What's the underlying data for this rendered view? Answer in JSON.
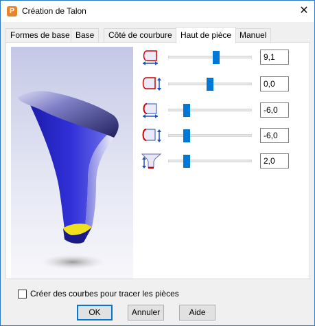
{
  "window": {
    "title": "Création de Talon",
    "app_icon_letter": "P",
    "close_glyph": "✕"
  },
  "tabs": [
    {
      "label": "Formes de base",
      "active": false
    },
    {
      "label": "Base",
      "active": false
    },
    {
      "label": "Côté de courbure",
      "active": false
    },
    {
      "label": "Haut de pièce",
      "active": true
    },
    {
      "label": "Manuel",
      "active": false
    }
  ],
  "rows": [
    {
      "icon": "heel-top-horizontal-icon",
      "value": "9,1",
      "slider_fraction": 0.58
    },
    {
      "icon": "heel-top-vertical-icon",
      "value": "0,0",
      "slider_fraction": 0.5
    },
    {
      "icon": "heel-front-horizontal-icon",
      "value": "-6,0",
      "slider_fraction": 0.2
    },
    {
      "icon": "heel-front-vertical-icon",
      "value": "-6,0",
      "slider_fraction": 0.2
    },
    {
      "icon": "heel-taper-icon",
      "value": "2,0",
      "slider_fraction": 0.2
    }
  ],
  "checkbox": {
    "label": "Créer des courbes pour tracer les pièces",
    "checked": false
  },
  "buttons": {
    "ok": "OK",
    "cancel": "Annuler",
    "help": "Aide"
  },
  "colors": {
    "accent": "#0078d7",
    "heel_blue": "#2a2ad0",
    "heel_sole": "#f0e020",
    "icon_red": "#cc0000"
  }
}
